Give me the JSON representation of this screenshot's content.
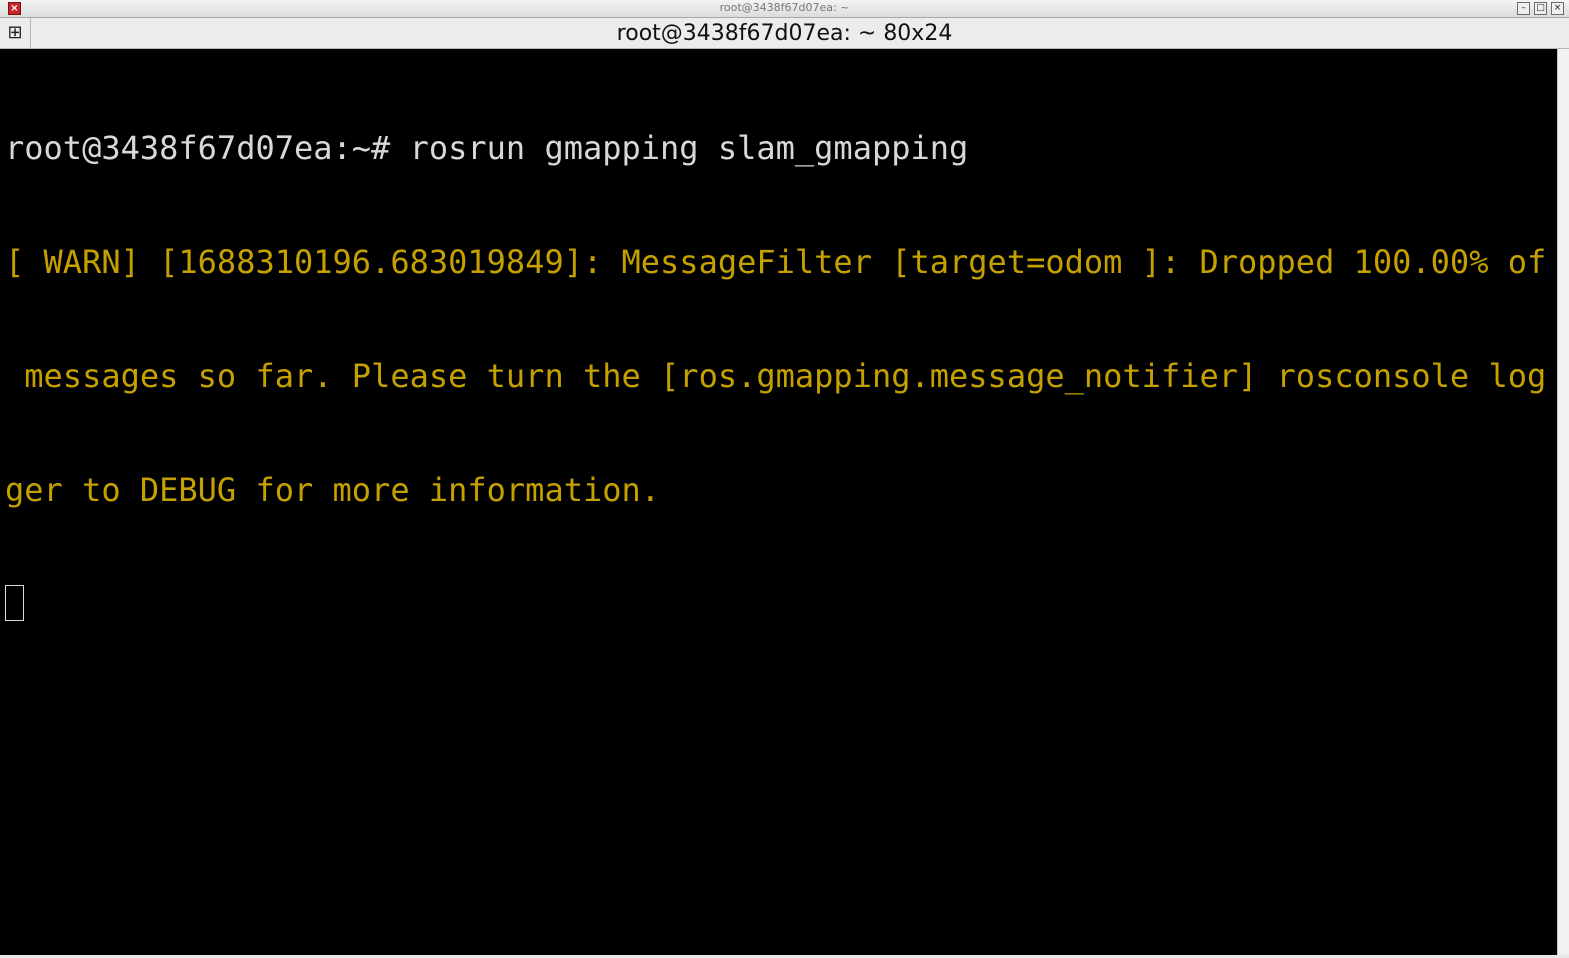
{
  "window": {
    "wm_title": "root@3438f67d07ea: ~",
    "close_icon": "close-icon",
    "minimize_icon": "minimize-icon",
    "maximize_icon": "maximize-icon"
  },
  "terminal": {
    "title": "root@3438f67d07ea: ~ 80x24",
    "menu_icon": "terminal-menu-icon",
    "lines": [
      {
        "kind": "prompt",
        "text": "root@3438f67d07ea:~# rosrun gmapping slam_gmapping"
      },
      {
        "kind": "warn",
        "text": "[ WARN] [1688310196.683019849]: MessageFilter [target=odom ]: Dropped 100.00% of"
      },
      {
        "kind": "warn",
        "text": " messages so far. Please turn the [ros.gmapping.message_notifier] rosconsole log"
      },
      {
        "kind": "warn",
        "text": "ger to DEBUG for more information."
      }
    ]
  },
  "colors": {
    "background": "#000000",
    "prompt_text": "#d8d8d8",
    "warn_text": "#c4a000"
  }
}
